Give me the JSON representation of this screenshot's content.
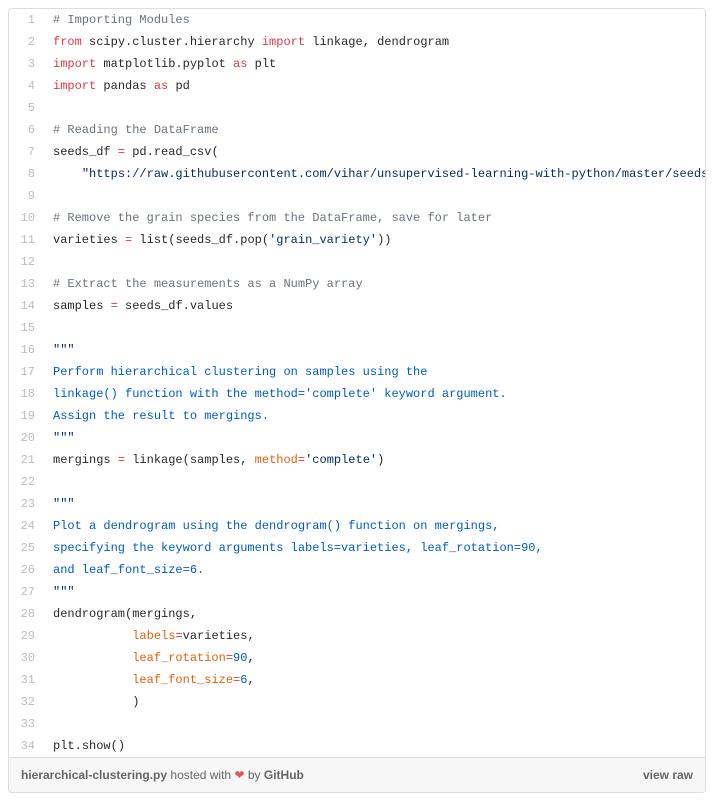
{
  "footer": {
    "filename": "hierarchical-clustering.py",
    "hosted": "hosted with",
    "by": "by",
    "host": "GitHub",
    "view_raw": "view raw"
  },
  "lines": [
    {
      "n": 1,
      "t": "comment",
      "text": "# Importing Modules"
    },
    {
      "n": 2,
      "t": "import1"
    },
    {
      "n": 3,
      "t": "import2"
    },
    {
      "n": 4,
      "t": "import3"
    },
    {
      "n": 5,
      "t": "blank"
    },
    {
      "n": 6,
      "t": "comment",
      "text": "# Reading the DataFrame"
    },
    {
      "n": 7,
      "t": "assign_readcsv"
    },
    {
      "n": 8,
      "t": "readcsv_arg"
    },
    {
      "n": 9,
      "t": "blank"
    },
    {
      "n": 10,
      "t": "comment",
      "text": "# Remove the grain species from the DataFrame, save for later"
    },
    {
      "n": 11,
      "t": "varieties"
    },
    {
      "n": 12,
      "t": "blank"
    },
    {
      "n": 13,
      "t": "comment",
      "text": "# Extract the measurements as a NumPy array"
    },
    {
      "n": 14,
      "t": "samples"
    },
    {
      "n": 15,
      "t": "blank"
    },
    {
      "n": 16,
      "t": "tq"
    },
    {
      "n": 17,
      "t": "doc",
      "text": "Perform hierarchical clustering on samples using the"
    },
    {
      "n": 18,
      "t": "doc",
      "text": "linkage() function with the method='complete' keyword argument."
    },
    {
      "n": 19,
      "t": "doc",
      "text": "Assign the result to mergings."
    },
    {
      "n": 20,
      "t": "tq"
    },
    {
      "n": 21,
      "t": "mergings"
    },
    {
      "n": 22,
      "t": "blank"
    },
    {
      "n": 23,
      "t": "tq"
    },
    {
      "n": 24,
      "t": "doc",
      "text": "Plot a dendrogram using the dendrogram() function on mergings,"
    },
    {
      "n": 25,
      "t": "doc",
      "text": "specifying the keyword arguments labels=varieties, leaf_rotation=90,"
    },
    {
      "n": 26,
      "t": "doc",
      "text": "and leaf_font_size=6."
    },
    {
      "n": 27,
      "t": "tq"
    },
    {
      "n": 28,
      "t": "dendro_open"
    },
    {
      "n": 29,
      "t": "dendro_labels"
    },
    {
      "n": 30,
      "t": "dendro_rot"
    },
    {
      "n": 31,
      "t": "dendro_font"
    },
    {
      "n": 32,
      "t": "dendro_close"
    },
    {
      "n": 33,
      "t": "blank"
    },
    {
      "n": 34,
      "t": "pltshow"
    }
  ],
  "tokens": {
    "from": "from",
    "import": "import",
    "as": "as",
    "scipy_path": "scipy.cluster.hierarchy",
    "linkage": "linkage",
    "dendrogram": "dendrogram",
    "mpl": "matplotlib.pyplot",
    "plt": "plt",
    "pandas": "pandas",
    "pd": "pd",
    "seeds_df": "seeds_df",
    "read_csv": "read_csv",
    "url": "\"https://raw.githubusercontent.com/vihar/unsupervised-learning-with-python/master/seeds",
    "varieties": "varieties",
    "list": "list",
    "pop": "pop",
    "grain_variety": "'grain_variety'",
    "samples": "samples",
    "values": "values",
    "tq": "\"\"\"",
    "mergings": "mergings",
    "method_kw": "method",
    "complete": "'complete'",
    "labels_kw": "labels",
    "leaf_rotation_kw": "leaf_rotation",
    "ninety": "90",
    "leaf_font_size_kw": "leaf_font_size",
    "six": "6",
    "show": "show"
  }
}
